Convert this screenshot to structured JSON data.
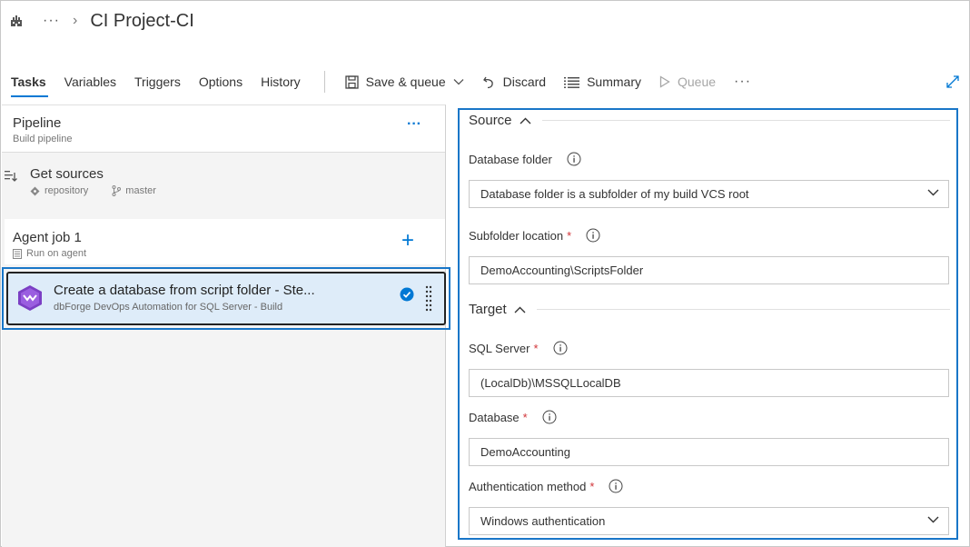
{
  "header": {
    "more": "···",
    "chevron": "›",
    "title": "CI Project-CI"
  },
  "tabs": [
    {
      "label": "Tasks",
      "active": true
    },
    {
      "label": "Variables"
    },
    {
      "label": "Triggers"
    },
    {
      "label": "Options"
    },
    {
      "label": "History"
    }
  ],
  "toolbar": {
    "save_queue": "Save & queue",
    "discard": "Discard",
    "summary": "Summary",
    "queue": "Queue",
    "more": "···"
  },
  "pipeline": {
    "title": "Pipeline",
    "subtitle": "Build pipeline",
    "more": "···"
  },
  "get_sources": {
    "title": "Get sources",
    "repository": "repository",
    "branch": "master"
  },
  "agent_job": {
    "title": "Agent job 1",
    "subtitle": "Run on agent",
    "add": "+"
  },
  "task": {
    "title": "Create a database from script folder - Ste...",
    "subtitle": "dbForge DevOps Automation for SQL Server - Build"
  },
  "source": {
    "title": "Source",
    "database_folder_label": "Database folder",
    "database_folder_value": "Database folder is a subfolder of my build VCS root",
    "subfolder_label": "Subfolder location",
    "subfolder_value": "DemoAccounting\\ScriptsFolder"
  },
  "target": {
    "title": "Target",
    "sql_server_label": "SQL Server",
    "sql_server_value": "(LocalDb)\\MSSQLLocalDB",
    "database_label": "Database",
    "database_value": "DemoAccounting",
    "auth_label": "Authentication method",
    "auth_value": "Windows authentication"
  },
  "required_mark": "*",
  "colors": {
    "accent": "#0078d4",
    "selection_border": "#1976c8",
    "task_bg": "#deecf9",
    "required": "#d13438"
  }
}
